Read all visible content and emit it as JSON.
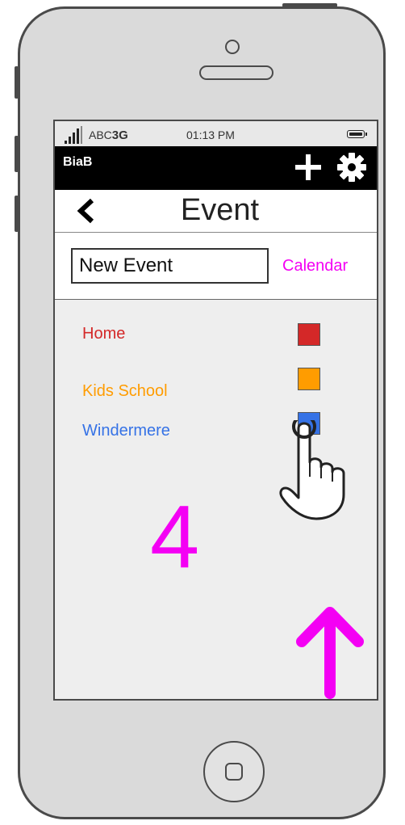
{
  "status_bar": {
    "carrier": "ABC",
    "network": "3G",
    "time": "01:13 PM"
  },
  "app_bar": {
    "title": "BiaB",
    "icons": [
      "plus-icon",
      "gear-icon"
    ]
  },
  "header": {
    "title": "Event",
    "back_icon": "chevron-left-icon"
  },
  "form": {
    "event_name_value": "New Event",
    "calendar_link": "Calendar"
  },
  "calendars": [
    {
      "label": "Home",
      "color": "#d42828"
    },
    {
      "label": "Kids School",
      "color": "#ff9c00"
    },
    {
      "label": "Windermere",
      "color": "#3572e6"
    }
  ],
  "annotation": {
    "step_number": "4",
    "color": "#f400f4"
  },
  "colors": {
    "accent": "#f400f4",
    "app_bar": "#000000",
    "screen_bg": "#eeeeee"
  }
}
